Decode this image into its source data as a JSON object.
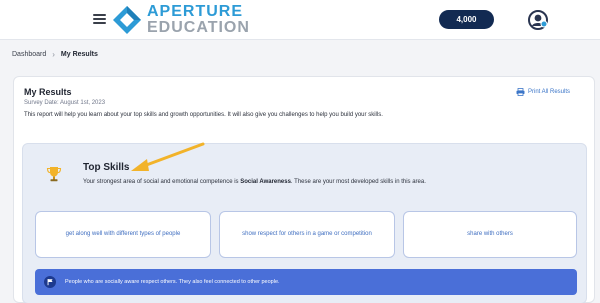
{
  "header": {
    "brand_line1": "APERTURE",
    "brand_line2": "EDUCATION",
    "points": "4,000",
    "icons": {
      "menu": "hamburger-icon",
      "logo": "diamond-logo",
      "avatar": "user-avatar-icon"
    }
  },
  "breadcrumb": {
    "root": "Dashboard",
    "separator": "›",
    "current": "My Results"
  },
  "results": {
    "title": "My Results",
    "survey_date": "Survey Date: August 1st, 2023",
    "description": "This report will help you learn about your top skills and growth opportunities. It will also give you challenges to help you build your skills.",
    "print_label": "Print All Results"
  },
  "top_skills": {
    "title": "Top Skills",
    "subtitle_pre": "Your strongest area of social and emotional competence is ",
    "subtitle_strong": "Social Awareness",
    "subtitle_post": ". These are your most developed skills in this area.",
    "tiles": [
      "get along well with different types of people",
      "show respect for others in a game or competition",
      "share with others"
    ],
    "info": "People who are socially aware respect others. They also feel connected to other people."
  },
  "colors": {
    "accent_blue": "#2d9bd6",
    "navy": "#122a52",
    "banner": "#4a6fd8",
    "arrow": "#f2b32a",
    "link": "#3c76c8"
  }
}
